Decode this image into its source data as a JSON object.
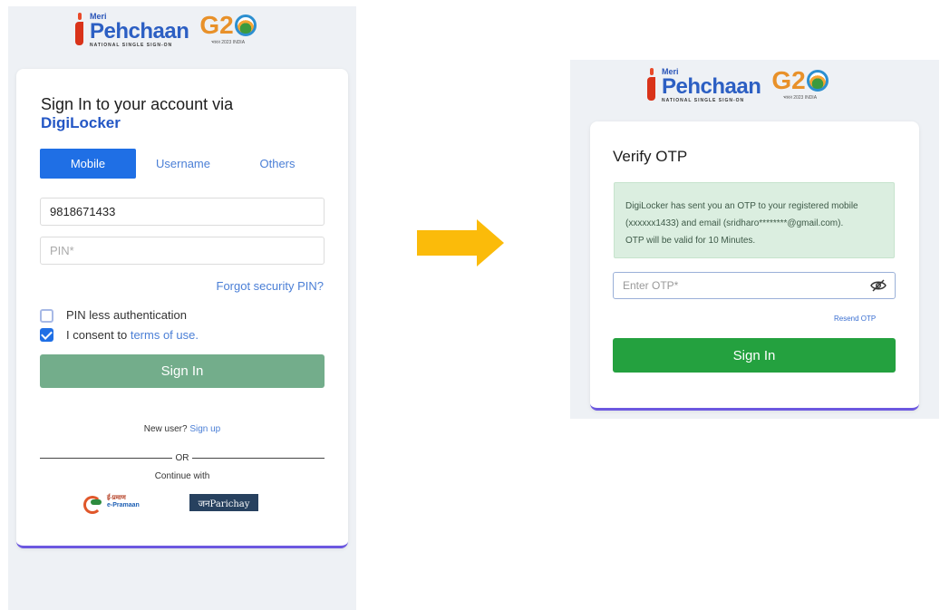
{
  "brand": {
    "meri": "Meri",
    "pehchaan": "Pehchaan",
    "tagline": "NATIONAL SINGLE SIGN-ON",
    "g20": "G2",
    "g20_sub": "भारत 2023 INDIA"
  },
  "login": {
    "title_line1": "Sign In to your account via",
    "title_line2": "DigiLocker",
    "tabs": [
      "Mobile",
      "Username",
      "Others"
    ],
    "mobile_value": "9818671433",
    "pin_placeholder": "PIN*",
    "forgot_pin": "Forgot security PIN?",
    "pinless_label": "PIN less authentication",
    "consent_prefix": "I consent to ",
    "consent_link": "terms of use.",
    "signin_label": "Sign In",
    "new_user": "New user?",
    "sign_up": "Sign up",
    "or": "OR",
    "continue_with": "Continue with",
    "epramaan_line1": "ई-प्रमाण",
    "epramaan_line2": "e-Pramaan",
    "janparichay": "जनParichay"
  },
  "otp": {
    "title": "Verify OTP",
    "message_line1": "DigiLocker has sent you an OTP to your registered mobile",
    "message_line2": "(xxxxxx1433) and email (sridharo********@gmail.com).",
    "message_line3": "OTP will be valid for 10 Minutes.",
    "otp_placeholder": "Enter OTP*",
    "resend": "Resend OTP",
    "signin_label": "Sign In"
  },
  "colors": {
    "primary_blue": "#1f6fe5",
    "signin_disabled": "#73ad8b",
    "signin_green": "#24a13f",
    "arrow": "#fbbb0a",
    "card_accent": "#6c58e0"
  }
}
